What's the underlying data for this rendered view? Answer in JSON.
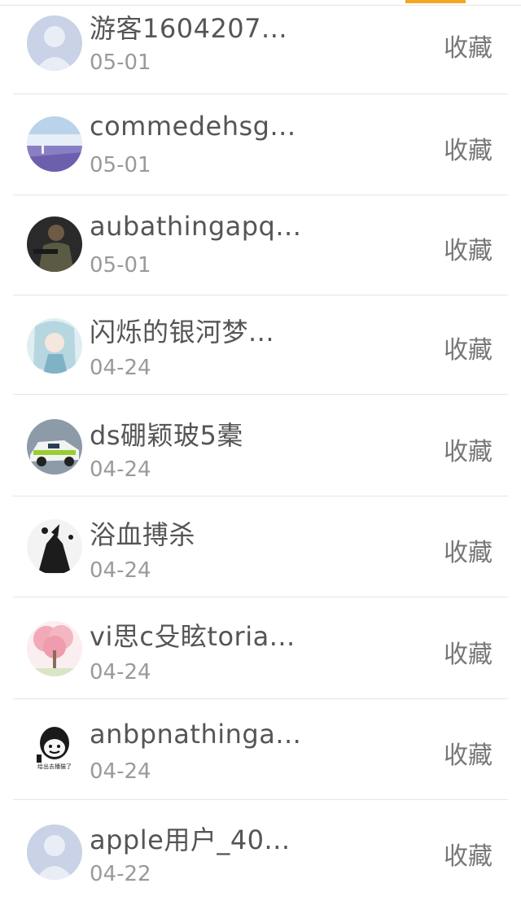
{
  "tab_indicator_color": "#f5a623",
  "rows": [
    {
      "name": "游客1604207...",
      "date": "05-01",
      "action": "收藏",
      "avatar": "default-person-icon"
    },
    {
      "name": "commedehsg...",
      "date": "05-01",
      "action": "收藏",
      "avatar": "lavender-field-photo"
    },
    {
      "name": "aubathingapq...",
      "date": "05-01",
      "action": "收藏",
      "avatar": "soldier-photo"
    },
    {
      "name": "闪烁的银河梦...",
      "date": "04-24",
      "action": "收藏",
      "avatar": "anime-girl-illustration"
    },
    {
      "name": "ds硼颖玻5橐",
      "date": "04-24",
      "action": "收藏",
      "avatar": "rally-car-photo"
    },
    {
      "name": "浴血搏杀",
      "date": "04-24",
      "action": "收藏",
      "avatar": "anime-character-silhouette"
    },
    {
      "name": "vi思c殳眩toria...",
      "date": "04-24",
      "action": "收藏",
      "avatar": "cherry-blossom-tree-illustration"
    },
    {
      "name": "anbpnathinga...",
      "date": "04-24",
      "action": "收藏",
      "avatar": "meme-face-sticker",
      "avatar_caption": "给出去播猫了"
    },
    {
      "name": "apple用户_40...",
      "date": "04-22",
      "action": "收藏",
      "avatar": "default-person-icon"
    }
  ]
}
